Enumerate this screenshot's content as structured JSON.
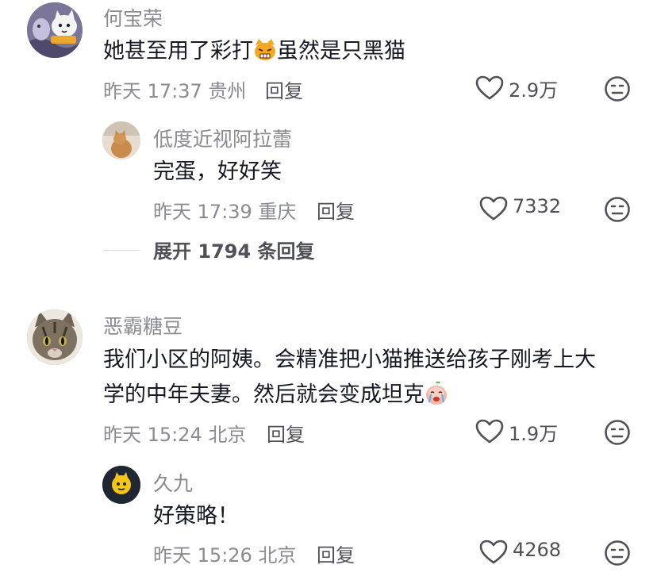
{
  "comments": [
    {
      "name": "何宝荣",
      "text_a": "她甚至用了彩打",
      "text_b": "虽然是只黑猫",
      "time": "昨天 17:37",
      "location": "贵州",
      "reply": "回复",
      "likes": "2.9万",
      "avatar_icon": "cartoon-cat-avatar",
      "emoji_icon": "angry-cat-emoji"
    },
    {
      "name": "低度近视阿拉蕾",
      "text": "完蛋，好好笑",
      "time": "昨天 17:39",
      "location": "重庆",
      "reply": "回复",
      "likes": "7332",
      "avatar_icon": "orange-cat-photo-avatar"
    },
    {
      "expand": "展开 1794 条回复"
    },
    {
      "name": "恶霸糖豆",
      "line1": "我们小区的阿姨。会精准把小猫推送给孩子刚考上大",
      "line2": "学的中年夫妻。然后就会变成坦克",
      "time": "昨天 15:24",
      "location": "北京",
      "reply": "回复",
      "likes": "1.9万",
      "avatar_icon": "tabby-cat-photo-avatar",
      "emoji_icon": "crying-face-emoji"
    },
    {
      "name": "久九",
      "text": "好策略！",
      "time": "昨天 15:26",
      "location": "北京",
      "reply": "回复",
      "likes": "4268",
      "avatar_icon": "yellow-cat-logo-avatar"
    }
  ],
  "colors": {
    "text": "#161823",
    "secondary": "#8a8b91",
    "action": "#505158"
  }
}
